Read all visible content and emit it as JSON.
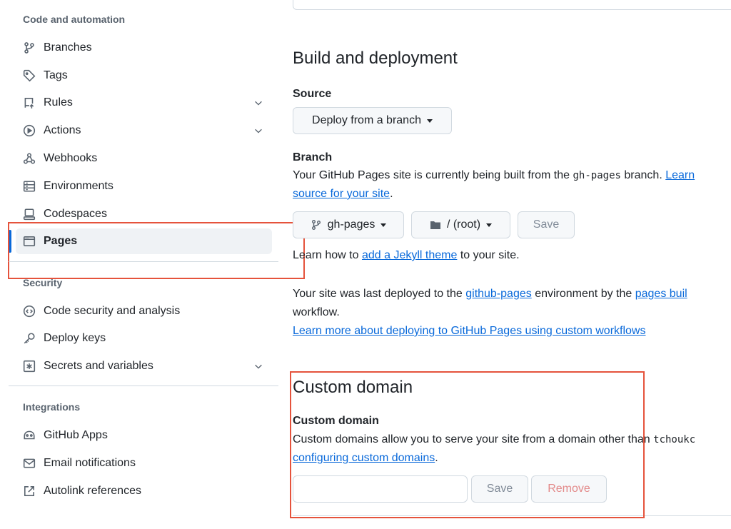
{
  "sidebar": {
    "heading_code": "Code and automation",
    "heading_security": "Security",
    "heading_integrations": "Integrations",
    "items": [
      {
        "label": "Branches",
        "icon": "git-branch-icon"
      },
      {
        "label": "Tags",
        "icon": "tag-icon"
      },
      {
        "label": "Rules",
        "icon": "repo-push-icon",
        "expandable": true
      },
      {
        "label": "Actions",
        "icon": "play-icon",
        "expandable": true
      },
      {
        "label": "Webhooks",
        "icon": "webhook-icon"
      },
      {
        "label": "Environments",
        "icon": "server-icon"
      },
      {
        "label": "Codespaces",
        "icon": "codespaces-icon"
      },
      {
        "label": "Pages",
        "icon": "browser-icon",
        "active": true
      },
      {
        "label": "Code security and analysis",
        "icon": "codescan-icon"
      },
      {
        "label": "Deploy keys",
        "icon": "key-icon"
      },
      {
        "label": "Secrets and variables",
        "icon": "key-asterisk-icon",
        "expandable": true
      },
      {
        "label": "GitHub Apps",
        "icon": "apps-icon"
      },
      {
        "label": "Email notifications",
        "icon": "mail-icon"
      },
      {
        "label": "Autolink references",
        "icon": "link-external-icon"
      }
    ]
  },
  "build": {
    "title": "Build and deployment",
    "source_label": "Source",
    "source_value": "Deploy from a branch",
    "branch_label": "Branch",
    "branch_desc_pre": "Your GitHub Pages site is currently being built from the",
    "branch_code": "gh-pages",
    "branch_desc_post": "branch.",
    "branch_link_1": "Learn",
    "branch_link_2": "source for your site",
    "branch_period": ".",
    "branch_select": "gh-pages",
    "folder_select": "/ (root)",
    "save_label": "Save",
    "jekyll_pre": "Learn how to",
    "jekyll_link": "add a Jekyll theme",
    "jekyll_post": "to your site.",
    "deployed_pre": "Your site was last deployed to the",
    "deployed_env_link": "github-pages",
    "deployed_mid": "environment by the",
    "deployed_build_link": "pages buil",
    "deployed_line2": "workflow.",
    "custom_workflows_link": "Learn more about deploying to GitHub Pages using custom workflows"
  },
  "custom_domain": {
    "title": "Custom domain",
    "label": "Custom domain",
    "desc_pre": "Custom domains allow you to serve your site from a domain other than",
    "desc_code": "tchoukc",
    "desc_link": "configuring custom domains",
    "desc_period": ".",
    "input_value": "",
    "save_label": "Save",
    "remove_label": "Remove"
  },
  "colors": {
    "accent": "#0969da",
    "annotation_box": "#e5533c"
  }
}
